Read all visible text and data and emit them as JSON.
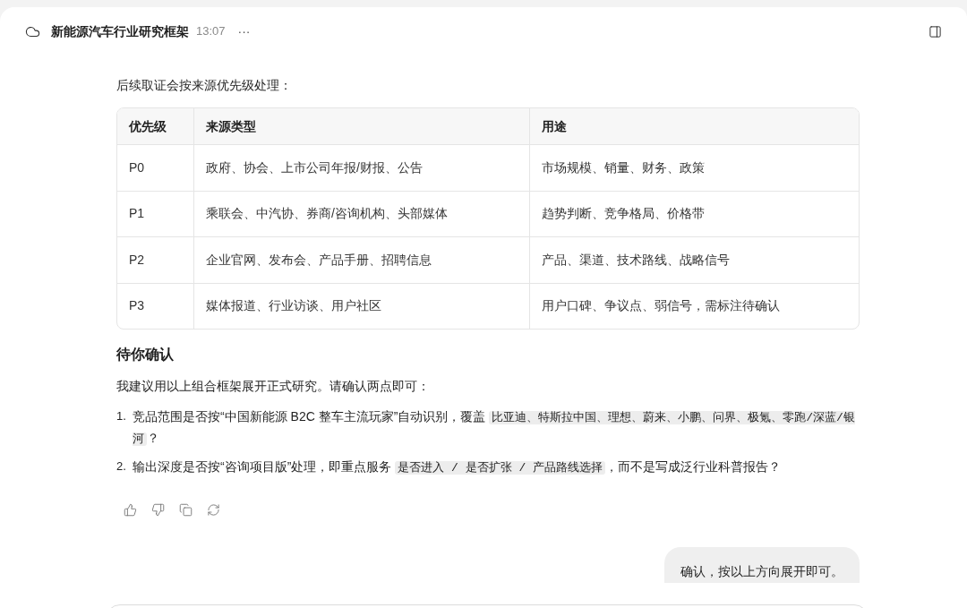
{
  "header": {
    "title": "新能源汽车行业研究框架",
    "time": "13:07",
    "more": "···"
  },
  "intro": "后续取证会按来源优先级处理：",
  "table": {
    "columns": [
      "优先级",
      "来源类型",
      "用途"
    ],
    "rows": [
      [
        "P0",
        "政府、协会、上市公司年报/财报、公告",
        "市场规模、销量、财务、政策"
      ],
      [
        "P1",
        "乘联会、中汽协、券商/咨询机构、头部媒体",
        "趋势判断、竞争格局、价格带"
      ],
      [
        "P2",
        "企业官网、发布会、产品手册、招聘信息",
        "产品、渠道、技术路线、战略信号"
      ],
      [
        "P3",
        "媒体报道、行业访谈、用户社区",
        "用户口碑、争议点、弱信号，需标注待确认"
      ]
    ]
  },
  "section_heading": "待你确认",
  "paragraph": "我建议用以上组合框架展开正式研究。请确认两点即可：",
  "list": [
    {
      "number": "1.",
      "segments": [
        {
          "kind": "text",
          "text": "竞品范围是否按“中国新能源 B2C 整车主流玩家”自动识别，覆盖 "
        },
        {
          "kind": "code",
          "text": "比亚迪、特斯拉中国、理想、蔚来、小鹏、问界、极氪、零跑/深蓝/银河"
        },
        {
          "kind": "text",
          "text": "？"
        }
      ]
    },
    {
      "number": "2.",
      "segments": [
        {
          "kind": "text",
          "text": "输出深度是否按“咨询项目版”处理，即重点服务 "
        },
        {
          "kind": "code",
          "text": "是否进入 / 是否扩张 / 产品路线选择"
        },
        {
          "kind": "text",
          "text": "，而不是写成泛行业科普报告？"
        }
      ]
    }
  ],
  "user_message": "确认，按以上方向展开即可。"
}
